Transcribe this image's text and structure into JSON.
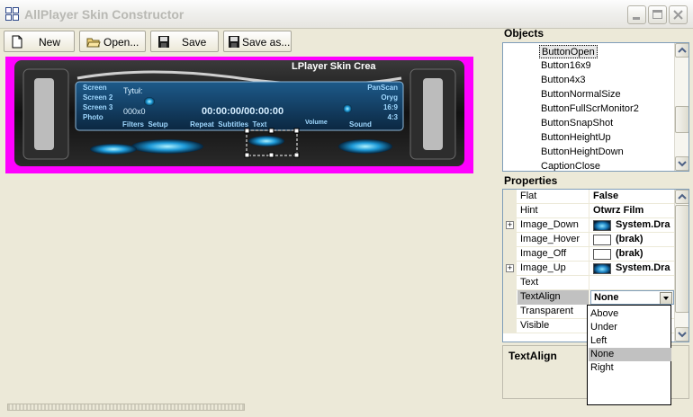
{
  "window": {
    "title": "AllPlayer Skin Constructor"
  },
  "toolbar": {
    "buttons": [
      {
        "label": "New",
        "icon": "new-file-icon"
      },
      {
        "label": "Open...",
        "icon": "open-folder-icon"
      },
      {
        "label": "Save",
        "icon": "floppy-disk-icon"
      },
      {
        "label": "Save as...",
        "icon": "floppy-disk-icon"
      }
    ]
  },
  "skin_preview": {
    "background_color": "#ff00ff",
    "title": "LPlayer Skin Crea",
    "left_menu": [
      "Screen",
      "Screen 2",
      "Screen 3",
      "Photo"
    ],
    "right_menu": [
      "PanScan",
      "Oryg",
      "16:9",
      "4:3"
    ],
    "track_label": "Tytuł:",
    "counter": "000x0",
    "time": "00:00:00/00:00:00",
    "bottom_labels": [
      "Filters",
      "Setup",
      "Repeat",
      "Subtitles",
      "Text"
    ],
    "volume_label": "Volume",
    "sound_label": "Sound"
  },
  "objects": {
    "header": "Objects",
    "items": [
      "ButtonOpen",
      "Button16x9",
      "Button4x3",
      "ButtonNormalSize",
      "ButtonFullScrMonitor2",
      "ButtonSnapShot",
      "ButtonHeightUp",
      "ButtonHeightDown",
      "CaptionClose"
    ],
    "selected": "ButtonOpen"
  },
  "properties": {
    "header": "Properties",
    "rows": [
      {
        "name": "Flat",
        "value": "False",
        "expandable": false,
        "swatch": ""
      },
      {
        "name": "Hint",
        "value": "Otwrz Film",
        "expandable": false,
        "swatch": ""
      },
      {
        "name": "Image_Down",
        "value": "System.Dra",
        "expandable": true,
        "swatch": "image"
      },
      {
        "name": "Image_Hover",
        "value": "(brak)",
        "expandable": false,
        "swatch": "empty"
      },
      {
        "name": "Image_Off",
        "value": "(brak)",
        "expandable": false,
        "swatch": "empty"
      },
      {
        "name": "Image_Up",
        "value": "System.Dra",
        "expandable": true,
        "swatch": "image"
      },
      {
        "name": "Text",
        "value": "",
        "expandable": false,
        "swatch": ""
      },
      {
        "name": "TextAlign",
        "value": "None",
        "expandable": false,
        "swatch": ""
      },
      {
        "name": "Transparent",
        "value": "",
        "expandable": false,
        "swatch": ""
      },
      {
        "name": "Visible",
        "value": "",
        "expandable": false,
        "swatch": ""
      }
    ],
    "selected": "TextAlign",
    "dropdown_options": [
      "Above",
      "Under",
      "Left",
      "None",
      "Right"
    ],
    "dropdown_selected": "None"
  },
  "description": {
    "title": "TextAlign"
  }
}
